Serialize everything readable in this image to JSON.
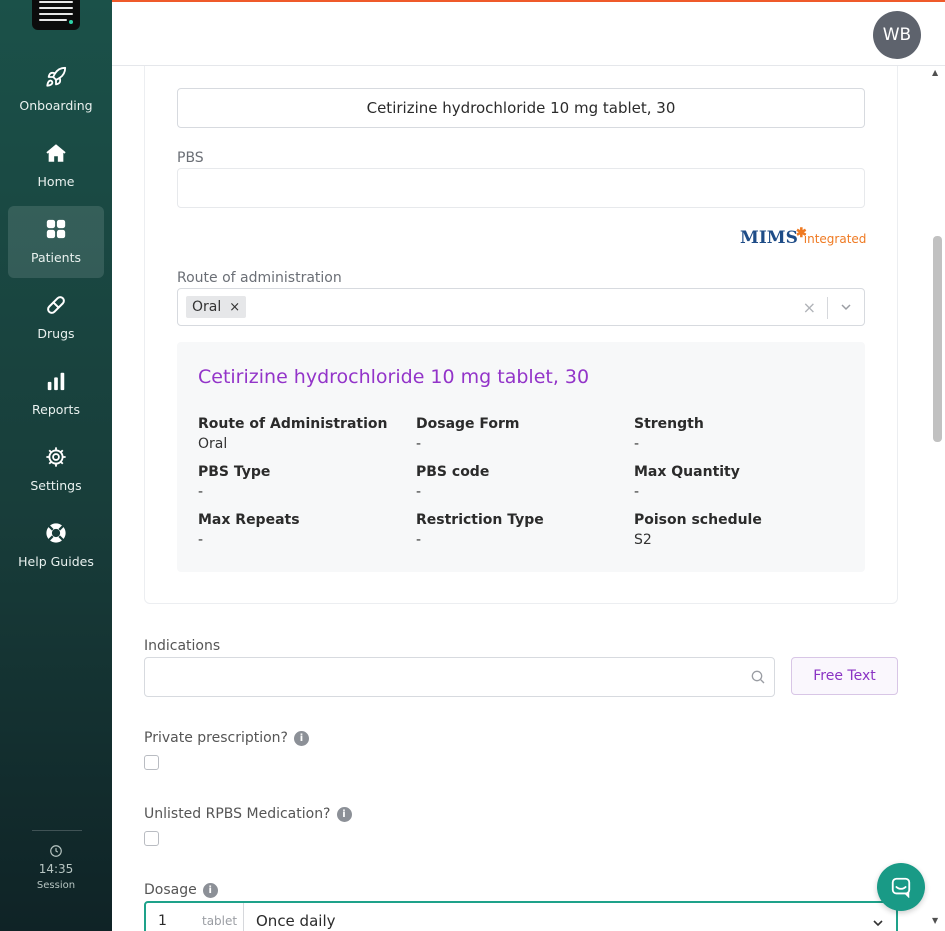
{
  "sidebar": {
    "items": [
      {
        "label": "Onboarding",
        "icon": "rocket-icon"
      },
      {
        "label": "Home",
        "icon": "home-icon"
      },
      {
        "label": "Patients",
        "icon": "grid-icon",
        "active": true
      },
      {
        "label": "Drugs",
        "icon": "pill-icon"
      },
      {
        "label": "Reports",
        "icon": "bar-chart-icon"
      },
      {
        "label": "Settings",
        "icon": "gear-icon"
      },
      {
        "label": "Help Guides",
        "icon": "lifebuoy-icon"
      }
    ],
    "session_time": "14:35",
    "session_label": "Session"
  },
  "header": {
    "avatar_initials": "WB"
  },
  "drug": {
    "name": "Cetirizine hydrochloride 10 mg tablet, 30",
    "pbs_label": "PBS",
    "pbs_value": "",
    "mims_logo": "MIMS",
    "mims_integrated": "integrated",
    "route_label": "Route of administration",
    "route_tag": "Oral",
    "route_tag_remove": "×",
    "route_clear": "×"
  },
  "info_panel": {
    "title": "Cetirizine hydrochloride 10 mg tablet, 30",
    "fields": [
      {
        "key": "Route of Administration",
        "value": "Oral"
      },
      {
        "key": "Dosage Form",
        "value": "-"
      },
      {
        "key": "Strength",
        "value": "-"
      },
      {
        "key": "PBS Type",
        "value": "-"
      },
      {
        "key": "PBS code",
        "value": "-"
      },
      {
        "key": "Max Quantity",
        "value": "-"
      },
      {
        "key": "Max Repeats",
        "value": "-"
      },
      {
        "key": "Restriction Type",
        "value": "-"
      },
      {
        "key": "Poison schedule",
        "value": "S2"
      }
    ]
  },
  "indications": {
    "label": "Indications",
    "value": "",
    "free_text_button": "Free Text"
  },
  "private_prescription": {
    "label": "Private prescription?",
    "info": "i",
    "checked": false
  },
  "unlisted_rpbs": {
    "label": "Unlisted RPBS Medication?",
    "info": "i",
    "checked": false
  },
  "dosage": {
    "label": "Dosage",
    "info": "i",
    "quantity": "1",
    "unit": "tablet",
    "frequency": "Once daily"
  },
  "colors": {
    "accent": "#199a86",
    "purple": "#9334c9",
    "sidebar": "#183d3a",
    "top_border": "#ef5a2a"
  }
}
